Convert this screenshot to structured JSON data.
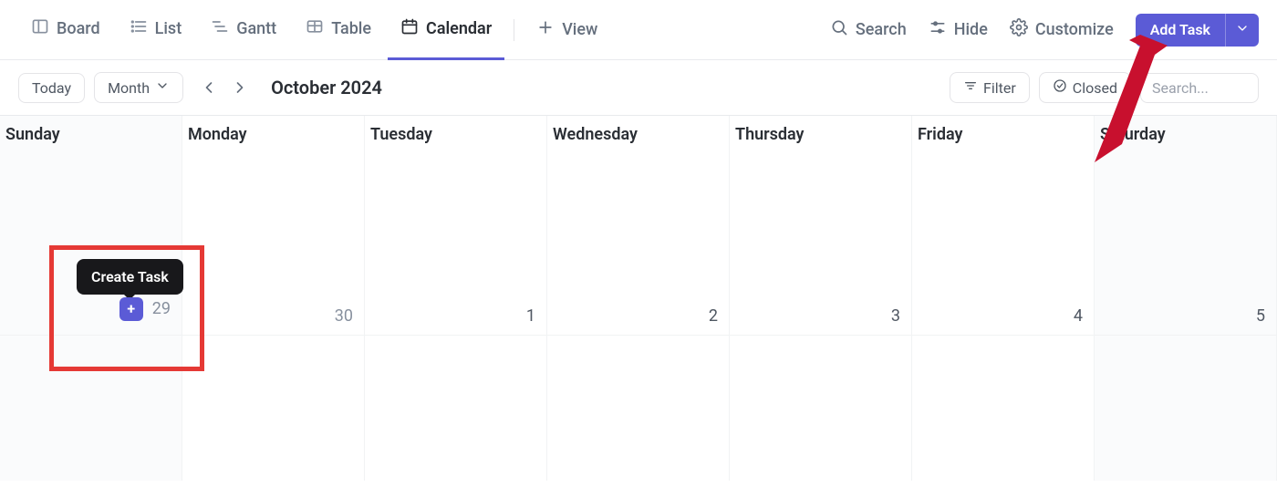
{
  "tabs": {
    "board": "Board",
    "list": "List",
    "gantt": "Gantt",
    "table": "Table",
    "calendar": "Calendar",
    "view": "View"
  },
  "top_actions": {
    "search": "Search",
    "hide": "Hide",
    "customize": "Customize",
    "add_task": "Add Task"
  },
  "toolbar": {
    "today": "Today",
    "period": "Month",
    "title": "October 2024",
    "filter": "Filter",
    "closed": "Closed",
    "search_placeholder": "Search..."
  },
  "weekdays": [
    "Sunday",
    "Monday",
    "Tuesday",
    "Wednesday",
    "Thursday",
    "Friday",
    "Saturday"
  ],
  "cells": {
    "r0c0": "29",
    "r0c1": "30",
    "r0c2": "1",
    "r0c3": "2",
    "r0c4": "3",
    "r0c5": "4",
    "r0c6": "5"
  },
  "tooltip": {
    "create_task": "Create Task"
  },
  "colors": {
    "accent": "#5b5bd6",
    "annotation": "#e53935"
  }
}
